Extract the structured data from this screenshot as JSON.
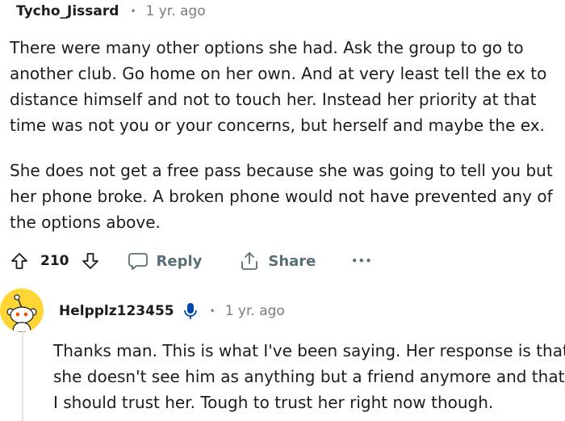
{
  "comment": {
    "username": "Tycho_Jissard",
    "separator": "•",
    "timestamp": "1 yr. ago",
    "paragraph1": [
      "There were many other options she had. Ask the group to go to",
      "another club. Go home on her own. And at very least tell the ex to",
      "distance himself and not to touch her. Instead her priority at that",
      "time was not you or your concerns, but herself and maybe the ex."
    ],
    "paragraph2": [
      "She does not get a free pass because she was going to tell you but",
      "her phone broke. A broken phone would not have prevented any of",
      "the options above."
    ],
    "actions": {
      "upvote_icon": "arrow-up-outline-icon",
      "vote_count": "210",
      "downvote_icon": "arrow-down-outline-icon",
      "reply_icon": "speech-bubble-icon",
      "reply_label": "Reply",
      "share_icon": "share-upload-icon",
      "share_label": "Share",
      "more_label": "•••"
    }
  },
  "reply": {
    "username": "Helpplz123455",
    "mic_icon": "microphone-icon",
    "separator": "•",
    "timestamp": "1 yr. ago",
    "lines": [
      "Thanks man. This is what I've been saying. Her response is that",
      "she doesn't see him as anything but a friend anymore and that",
      "I should trust her. Tough to trust her right now though."
    ],
    "avatar_color": "#ffd635"
  },
  "colors": {
    "text": "#1c1c1c",
    "meta": "#7c7c7c",
    "action": "#576f76",
    "mic": "#0045ac"
  }
}
